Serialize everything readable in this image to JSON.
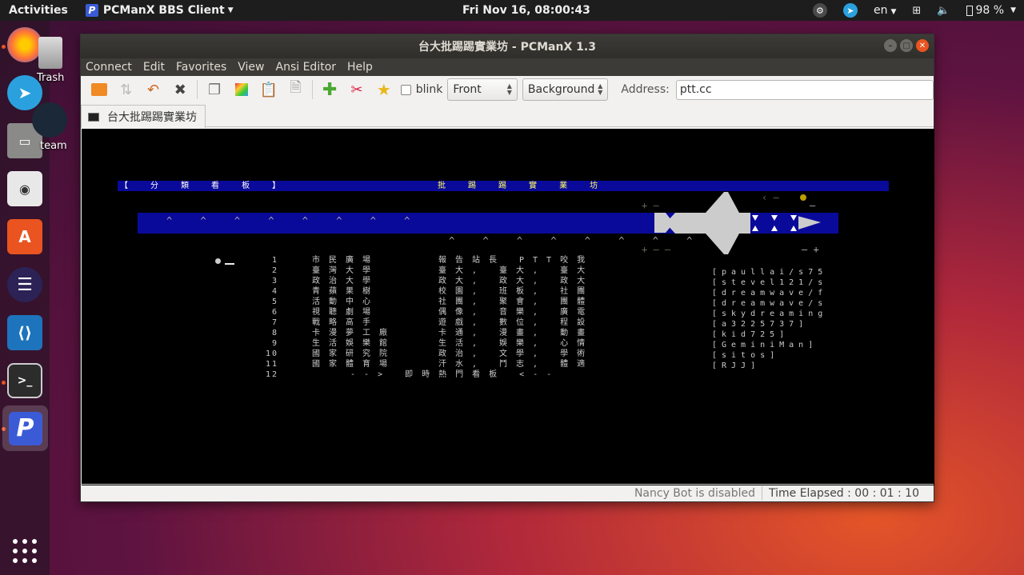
{
  "topbar": {
    "activities": "Activities",
    "app_name": "PCManX BBS Client",
    "clock": "Fri Nov 16, 08:00:43",
    "lang": "en",
    "battery": "98 %"
  },
  "desktop": {
    "trash_label": "Trash",
    "steam_label": "team"
  },
  "window": {
    "title": "台大批踢踢實業坊 - PCManX 1.3",
    "menu": [
      "Connect",
      "Edit",
      "Favorites",
      "View",
      "Ansi Editor",
      "Help"
    ],
    "blink_label": "blink",
    "front_value": "Front",
    "background_value": "Background",
    "address_label": "Address:",
    "address_value": "ptt.cc",
    "tab_label": "台大批踢踢實業坊",
    "status_bot": "Nancy Bot is disabled",
    "status_time": "Time Elapsed : 00 : 01 : 10"
  },
  "terminal": {
    "header_left": "【 分 類 看 板 】",
    "header_center": "批 踢 踢 實 業 坊",
    "carets_top": "^ ^ ^ ^ ^ ^ ^ ^",
    "carets_bottom": "^ ^ ^ ^ ^ ^ ^ ^",
    "rows": [
      {
        "num": "1",
        "a": "市民廣場",
        "b": "報告站長 PTT咬我"
      },
      {
        "num": "2",
        "a": "臺灣大學",
        "b": "臺大, 臺大, 臺大"
      },
      {
        "num": "3",
        "a": "政治大學",
        "b": "政大, 政大, 政大"
      },
      {
        "num": "4",
        "a": "青蘋果樹",
        "b": "校園, 班板, 社團"
      },
      {
        "num": "5",
        "a": "活動中心",
        "b": "社團, 聚會, 團體"
      },
      {
        "num": "6",
        "a": "視聽劇場",
        "b": "偶像, 音樂, 廣電"
      },
      {
        "num": "7",
        "a": "戰略高手",
        "b": "遊戲, 數位, 程設"
      },
      {
        "num": "8",
        "a": "卡漫夢工廠",
        "b": "卡通, 漫畫, 動畫"
      },
      {
        "num": "9",
        "a": "生活娛樂館",
        "b": "生活, 娛樂, 心情"
      },
      {
        "num": "10",
        "a": "國家研究院",
        "b": "政治, 文學, 學術"
      },
      {
        "num": "11",
        "a": "國家體育場",
        "b": "汗水, 鬥志, 體適"
      },
      {
        "num": "12",
        "a": "--> 即時熱門看板 <--",
        "b": ""
      }
    ],
    "users": [
      "[paullai/s75",
      "[stevel121/s",
      "[dreamwave/f",
      "[dreamwave/s",
      "[skydreaming",
      "[a3225737]",
      "[kid725]",
      "[GeminiMan]",
      "[sitos]",
      "[RJJ]"
    ]
  }
}
